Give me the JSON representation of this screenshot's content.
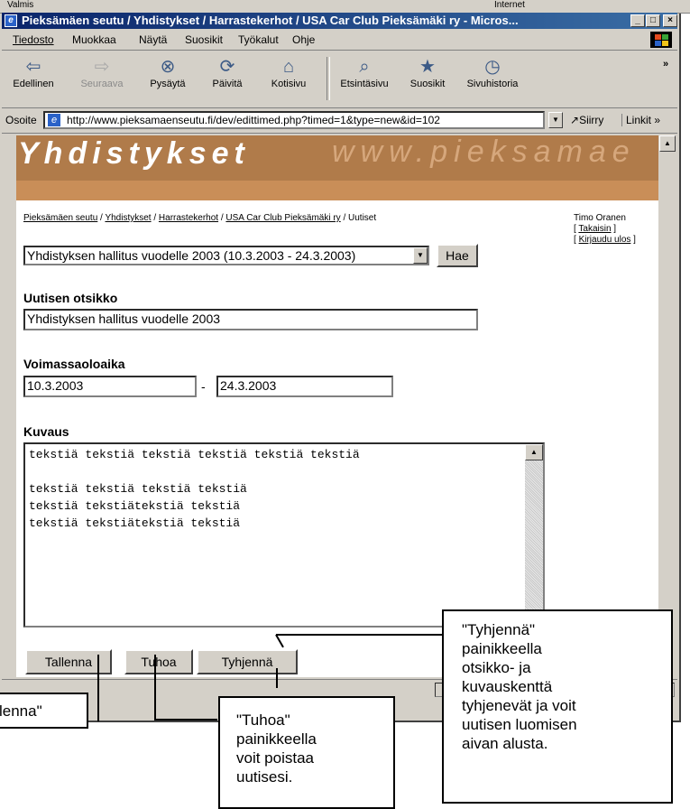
{
  "window": {
    "prev_left": "Valmis",
    "prev_right": "Internet",
    "title": "Pieksämäen seutu / Yhdistykset / Harrastekerhot / USA Car Club Pieksämäki ry - Micros...",
    "min": "_",
    "max": "□",
    "close": "×"
  },
  "menu": [
    "Tiedosto",
    "Muokkaa",
    "Näytä",
    "Suosikit",
    "Työkalut",
    "Ohje"
  ],
  "toolbar": {
    "back": "Edellinen",
    "forward": "Seuraava",
    "stop": "Pysäytä",
    "refresh": "Päivitä",
    "home": "Kotisivu",
    "search": "Etsintäsivu",
    "favorites": "Suosikit",
    "history": "Sivuhistoria",
    "more": "»"
  },
  "address": {
    "label": "Osoite",
    "url": "http://www.pieksamaenseutu.fi/dev/edittimed.php?timed=1&type=new&id=102",
    "go": "Siirry",
    "links": "Linkit »"
  },
  "banner": {
    "title": "Yhdistykset",
    "site": "www.pieksamae"
  },
  "breadcrumb": {
    "items": [
      "Pieksämäen seutu",
      "Yhdistykset",
      "Harrastekerhot",
      "USA Car Club Pieksämäki ry"
    ],
    "sep": " / ",
    "current": "Uutiset"
  },
  "user": {
    "name": "Timo Oranen",
    "back": "Takaisin",
    "logout": "Kirjaudu ulos"
  },
  "form": {
    "news_select": "Yhdistyksen hallitus vuodelle 2003 (10.3.2003 - 24.3.2003)",
    "fetch_button": "Hae",
    "title_label": "Uutisen otsikko",
    "title_value": "Yhdistyksen hallitus vuodelle 2003",
    "validity_label": "Voimassaoloaika",
    "start_date": "10.3.2003",
    "dash": "-",
    "end_date": "24.3.2003",
    "description_label": "Kuvaus",
    "description_text": "tekstiä tekstiä tekstiä tekstiä tekstiä tekstiä\n\ntekstiä tekstiä tekstiä tekstiä\ntekstiä tekstiätekstiä tekstiä\ntekstiä tekstiätekstiä tekstiä",
    "save_button": "Tallenna",
    "delete_button": "Tuhoa",
    "clear_button": "Tyhjennä"
  },
  "callouts": {
    "save": "lenna\"",
    "delete": "\"Tuhoa\"\npainikkeella\nvoit poistaa\nuutisesi.",
    "clear": "\"Tyhjennä\"\npainikkeella\notsikko- ja\nkuvauskenttä\ntyhjenevät ja voit\nuutisen luomisen\naivan alusta."
  }
}
